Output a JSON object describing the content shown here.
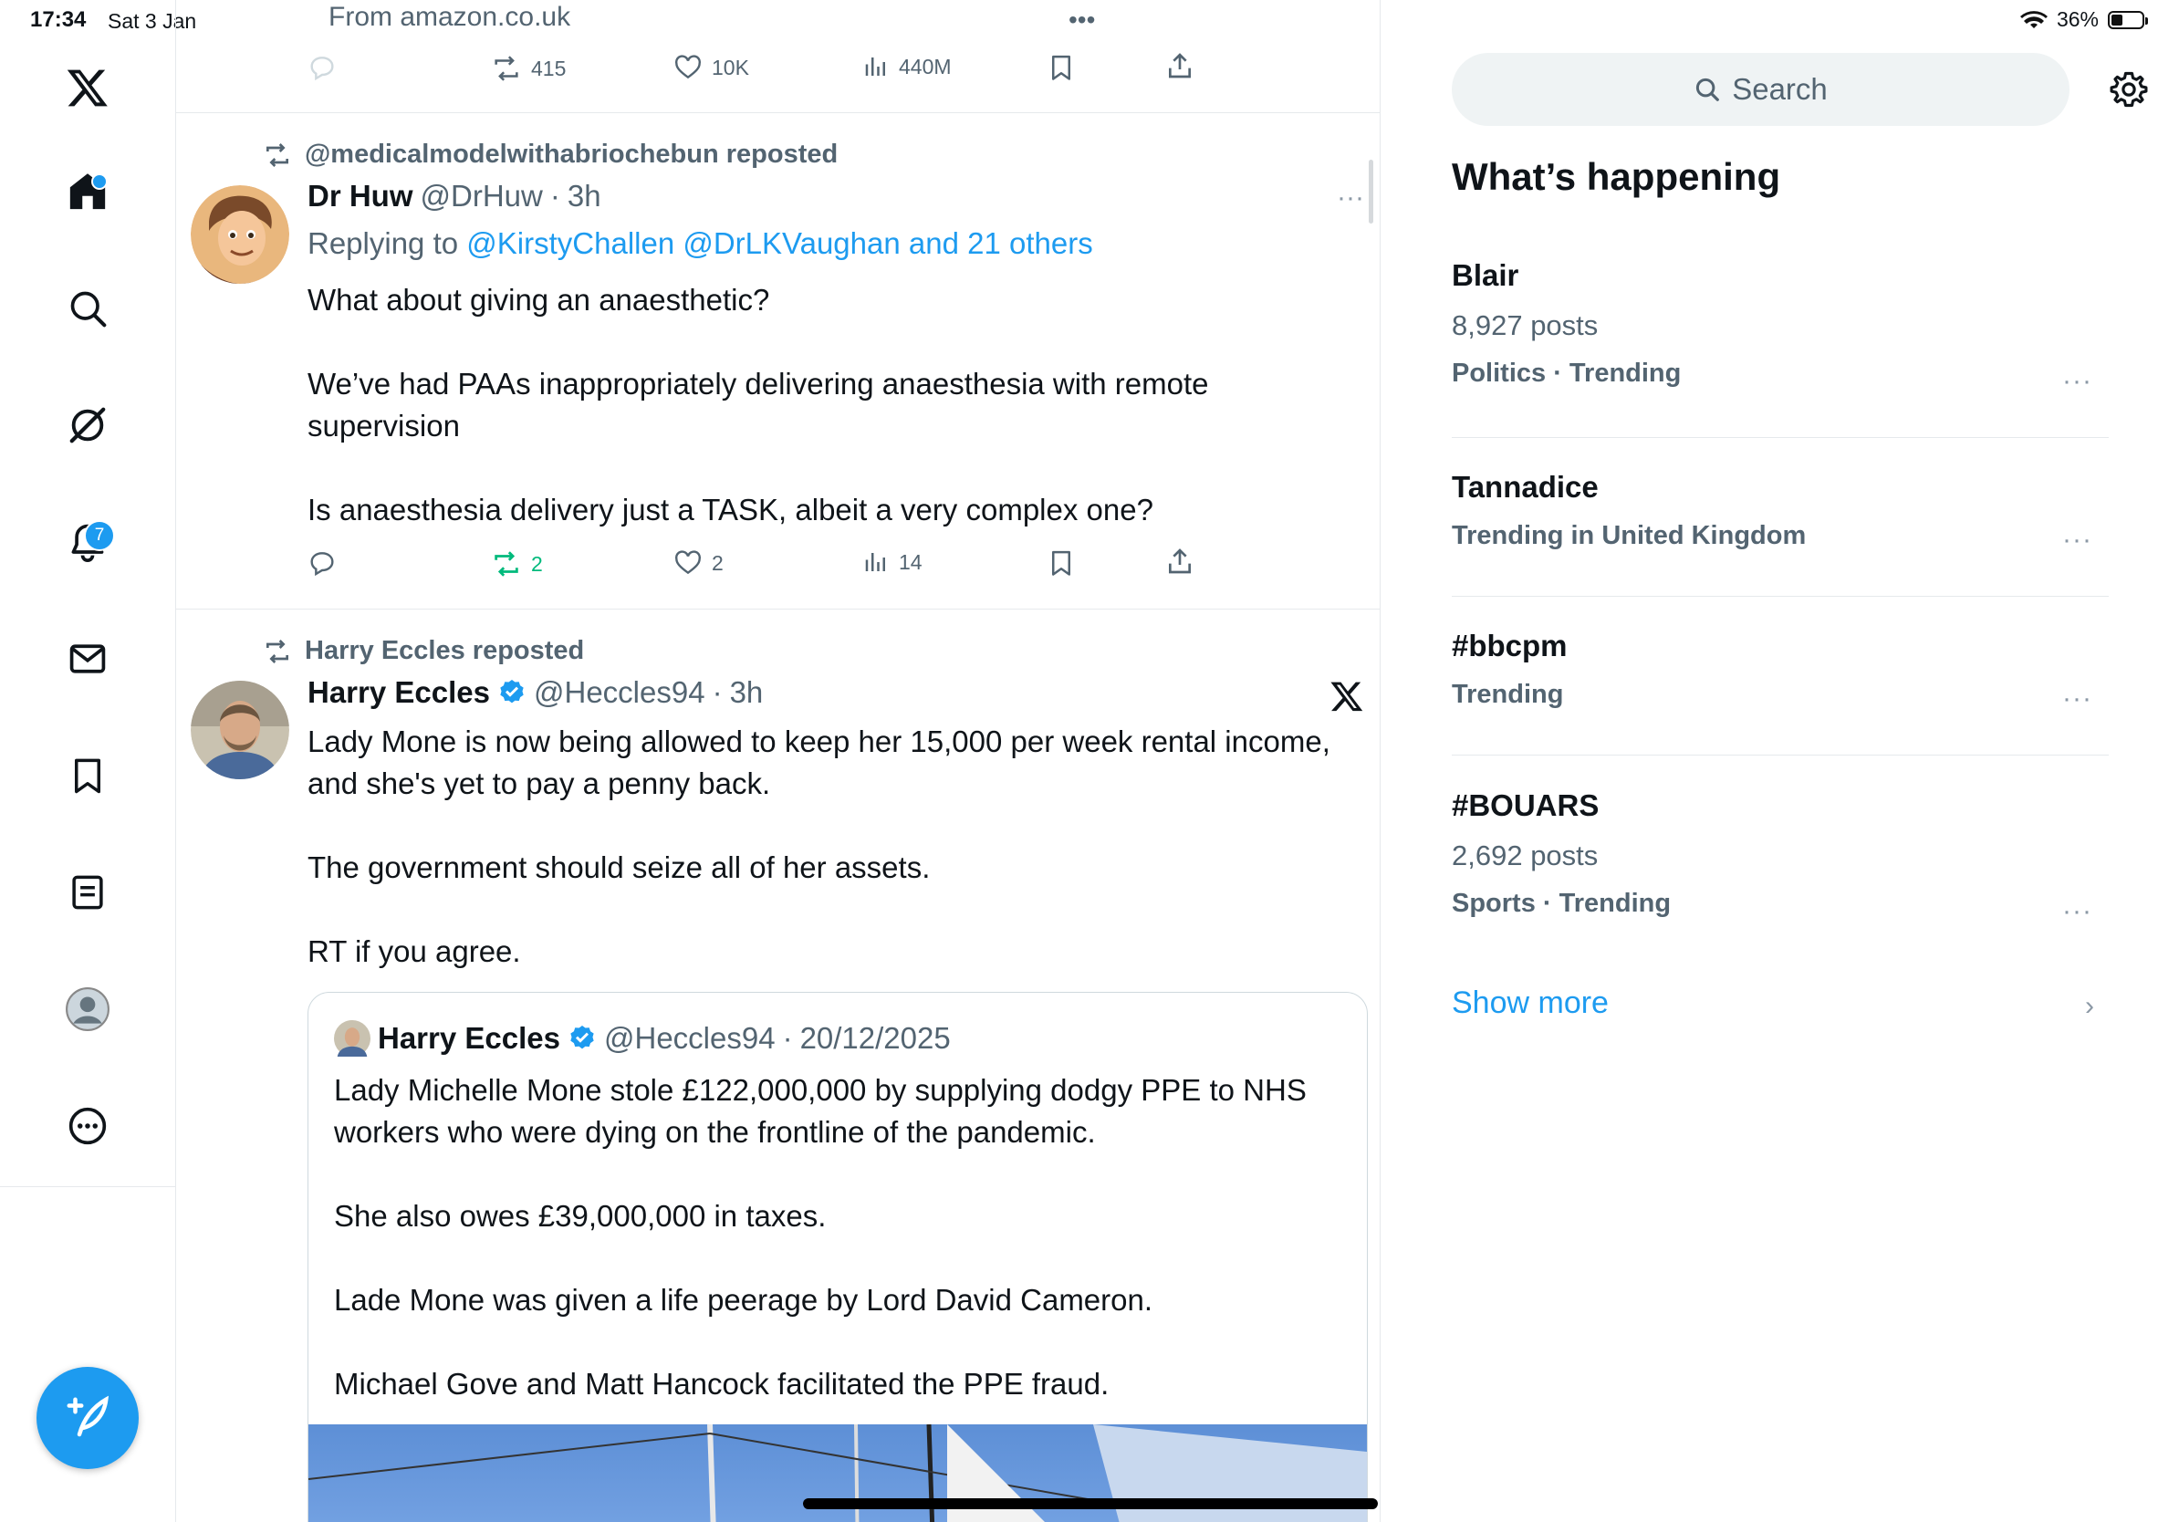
{
  "status": {
    "time": "17:34",
    "date": "Sat 3 Jan",
    "battery": "36%",
    "battery_level": 0.36
  },
  "nav": {
    "items": [
      "x-logo",
      "home",
      "search",
      "grok",
      "notifications",
      "messages",
      "bookmarks",
      "lists",
      "profile",
      "more"
    ],
    "notifications_count": "7"
  },
  "top_tweet": {
    "source": "From amazon.co.uk",
    "stats": {
      "replies": "",
      "reposts": "415",
      "likes": "10K",
      "views": "440M"
    }
  },
  "tweet1": {
    "repost_by": "@medicalmodelwithabriochebun reposted",
    "name": "Dr Huw",
    "handle": "@DrHuw",
    "time": "3h",
    "replying_label": "Replying to",
    "replying_to": "@KirstyChallen @DrLKVaughan and 21 others",
    "para1": "What about giving an anaesthetic?",
    "para2": "We’ve had PAAs inappropriately delivering anaesthesia with remote supervision",
    "para3": "Is anaesthesia delivery just a TASK, albeit a very complex one?",
    "stats": {
      "reposts": "2",
      "likes": "2",
      "views": "14"
    },
    "reposted_color": "#00ba7c"
  },
  "tweet2": {
    "repost_by": "Harry Eccles reposted",
    "name": "Harry Eccles",
    "handle": "@Heccles94",
    "time": "3h",
    "para1": "Lady Mone is now being allowed to keep her 15,000 per week rental income, and she's yet to pay a penny back.",
    "para2": "The government should seize all of her assets.",
    "para3": "RT if you agree.",
    "quote": {
      "name": "Harry Eccles",
      "handle": "@Heccles94",
      "date": "20/12/2025",
      "para1": "Lady Michelle Mone stole £122,000,000 by supplying dodgy PPE to NHS workers who were dying on the frontline of the pandemic.",
      "para2": "She also owes £39,000,000 in taxes.",
      "para3": "Lade Mone was given a life peerage by Lord David Cameron.",
      "para4": "Michael Gove and Matt Hancock facilitated the PPE fraud."
    }
  },
  "sidebar": {
    "search_placeholder": "Search",
    "title": "What’s happening",
    "trends": [
      {
        "title": "Blair",
        "posts": "8,927 posts",
        "meta": "Politics · Trending"
      },
      {
        "title": "Tannadice",
        "posts": "",
        "meta": "Trending in United Kingdom"
      },
      {
        "title": "#bbcpm",
        "posts": "",
        "meta": "Trending"
      },
      {
        "title": "#BOUARS",
        "posts": "2,692 posts",
        "meta": "Sports · Trending"
      }
    ],
    "show_more": "Show more"
  },
  "colors": {
    "accent": "#1d9bf0",
    "verified": "#1d9bf0",
    "muted": "#536471",
    "repost_green": "#00ba7c"
  }
}
